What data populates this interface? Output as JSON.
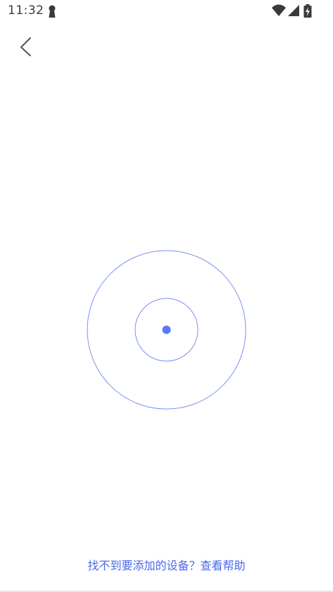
{
  "status_bar": {
    "time": "11:32",
    "left_icon": "keyhole-icon",
    "right_icons": [
      "wifi-icon",
      "cell-signal-icon",
      "battery-charging-icon"
    ]
  },
  "nav": {
    "back_icon": "chevron-left-icon"
  },
  "scanner": {
    "icon": "radar-scan-icon",
    "accent_color": "#5b78f6"
  },
  "footer": {
    "help_text": "找不到要添加的设备？查看帮助",
    "link_color": "#4b68ea"
  }
}
